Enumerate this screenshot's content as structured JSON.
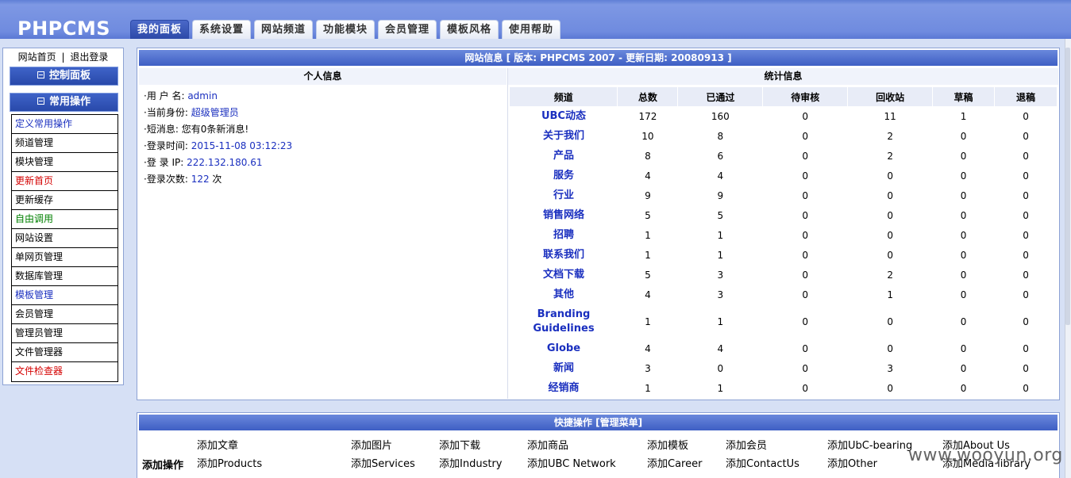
{
  "app": {
    "logo": "PHPCMS"
  },
  "tabs": [
    {
      "label": "我的面板",
      "active": true
    },
    {
      "label": "系统设置"
    },
    {
      "label": "网站频道"
    },
    {
      "label": "功能模块"
    },
    {
      "label": "会员管理"
    },
    {
      "label": "模板风格"
    },
    {
      "label": "使用帮助"
    }
  ],
  "sidebar": {
    "links": {
      "home": "网站首页",
      "sep": "|",
      "logout": "退出登录"
    },
    "control_panel": "控制面板",
    "common_ops": "常用操作",
    "items": [
      {
        "label": "定义常用操作",
        "color": "#1a2fbf"
      },
      {
        "label": "频道管理",
        "color": "#000000"
      },
      {
        "label": "模块管理",
        "color": "#000000"
      },
      {
        "label": "更新首页",
        "color": "#d40000"
      },
      {
        "label": "更新缓存",
        "color": "#000000"
      },
      {
        "label": "自由调用",
        "color": "#008000"
      },
      {
        "label": "网站设置",
        "color": "#000000"
      },
      {
        "label": "单网页管理",
        "color": "#000000"
      },
      {
        "label": "数据库管理",
        "color": "#000000"
      },
      {
        "label": "模板管理",
        "color": "#1a2fbf"
      },
      {
        "label": "会员管理",
        "color": "#000000"
      },
      {
        "label": "管理员管理",
        "color": "#000000"
      },
      {
        "label": "文件管理器",
        "color": "#000000"
      },
      {
        "label": "文件检查器",
        "color": "#d40000"
      }
    ]
  },
  "site_info": {
    "title": "网站信息 [ 版本: PHPCMS 2007 - 更新日期: 20080913 ]"
  },
  "personal": {
    "heading": "个人信息",
    "username_label": "·用 户 名:",
    "username": "admin",
    "role_label": "·当前身份:",
    "role": "超级管理员",
    "msg_label": "·短消息:",
    "msg": "您有0条新消息!",
    "login_time_label": "·登录时间:",
    "login_time": "2015-11-08 03:12:23",
    "login_ip_label": "·登 录 IP:",
    "login_ip": "222.132.180.61",
    "login_count_label": "·登录次数:",
    "login_count": "122",
    "login_count_unit": "次"
  },
  "stats": {
    "heading": "统计信息",
    "columns": [
      "频道",
      "总数",
      "已通过",
      "待审核",
      "回收站",
      "草稿",
      "退稿"
    ],
    "rows": [
      [
        "UBC动态",
        "172",
        "160",
        "0",
        "11",
        "1",
        "0"
      ],
      [
        "关于我们",
        "10",
        "8",
        "0",
        "2",
        "0",
        "0"
      ],
      [
        "产品",
        "8",
        "6",
        "0",
        "2",
        "0",
        "0"
      ],
      [
        "服务",
        "4",
        "4",
        "0",
        "0",
        "0",
        "0"
      ],
      [
        "行业",
        "9",
        "9",
        "0",
        "0",
        "0",
        "0"
      ],
      [
        "销售网络",
        "5",
        "5",
        "0",
        "0",
        "0",
        "0"
      ],
      [
        "招聘",
        "1",
        "1",
        "0",
        "0",
        "0",
        "0"
      ],
      [
        "联系我们",
        "1",
        "1",
        "0",
        "0",
        "0",
        "0"
      ],
      [
        "文档下载",
        "5",
        "3",
        "0",
        "2",
        "0",
        "0"
      ],
      [
        "其他",
        "4",
        "3",
        "0",
        "1",
        "0",
        "0"
      ],
      [
        "Branding Guidelines",
        "1",
        "1",
        "0",
        "0",
        "0",
        "0"
      ],
      [
        "Globe",
        "4",
        "4",
        "0",
        "0",
        "0",
        "0"
      ],
      [
        "新闻",
        "3",
        "0",
        "0",
        "3",
        "0",
        "0"
      ],
      [
        "经销商",
        "1",
        "1",
        "0",
        "0",
        "0",
        "0"
      ]
    ]
  },
  "quick": {
    "title": "快捷操作 [管理菜单]",
    "label": "添加操作",
    "row1": [
      "添加文章",
      "添加图片",
      "添加下载",
      "添加商品",
      "添加模板",
      "添加会员",
      "添加UbC-bearing",
      "添加About Us"
    ],
    "row2": [
      "添加Products",
      "添加Services",
      "添加Industry",
      "添加UBC Network",
      "添加Career",
      "添加ContactUs",
      "添加Other",
      "添加Media library"
    ]
  },
  "watermark": "www.wooyun.org"
}
